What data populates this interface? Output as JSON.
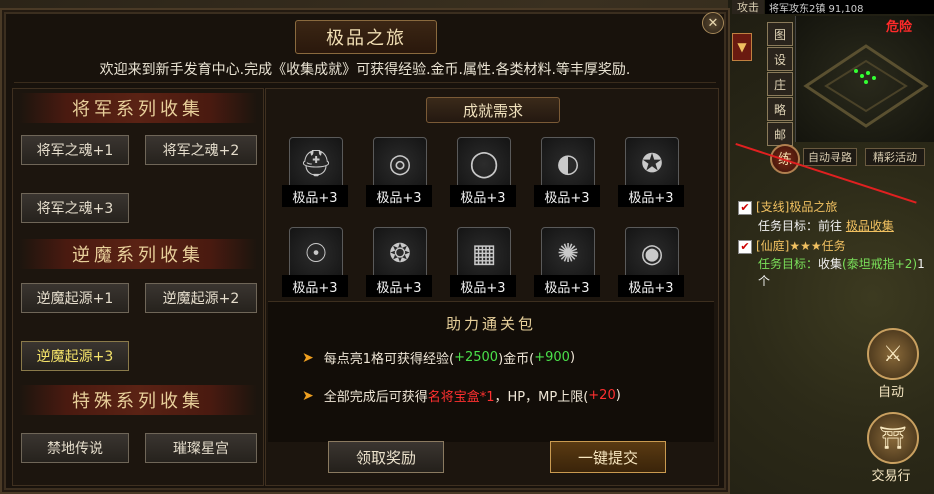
{
  "panel": {
    "title": "极品之旅",
    "close_glyph": "✕",
    "intro": "欢迎来到新手发育中心.完成《收集成就》可获得经验.金币.属性.各类材料.等丰厚奖励."
  },
  "categories": [
    {
      "label": "将军系列收集",
      "items": [
        "将军之魂+1",
        "将军之魂+2",
        "将军之魂+3"
      ]
    },
    {
      "label": "逆魔系列收集",
      "items": [
        "逆魔起源+1",
        "逆魔起源+2",
        "逆魔起源+3"
      ]
    },
    {
      "label": "特殊系列收集",
      "items": [
        "禁地传说",
        "璀璨星宫"
      ]
    }
  ],
  "requirements": {
    "title": "成就需求",
    "slots": [
      {
        "icon": "helmet-icon",
        "glyph": "⛑",
        "label": "极品+3"
      },
      {
        "icon": "necklace-icon",
        "glyph": "◎",
        "label": "极品+3"
      },
      {
        "icon": "ring-icon",
        "glyph": "◯",
        "label": "极品+3"
      },
      {
        "icon": "bracelet-icon",
        "glyph": "◐",
        "label": "极品+3"
      },
      {
        "icon": "ring-icon",
        "glyph": "✪",
        "label": "极品+3"
      },
      {
        "icon": "medal-icon",
        "glyph": "☉",
        "label": "极品+3"
      },
      {
        "icon": "belt-icon",
        "glyph": "❂",
        "label": "极品+3"
      },
      {
        "icon": "bracer-icon",
        "glyph": "▦",
        "label": "极品+3"
      },
      {
        "icon": "amulet-icon",
        "glyph": "✺",
        "label": "极品+3"
      },
      {
        "icon": "ring-icon",
        "glyph": "◉",
        "label": "极品+3"
      }
    ]
  },
  "rewards": {
    "title": "助力通关包",
    "line1": {
      "a": "每点亮1格可获得经验(",
      "b": "+2500",
      "c": ")金币(",
      "d": "+900",
      "e": ")"
    },
    "line2": {
      "a": "全部完成后可获得",
      "b": "名将宝盒*1",
      "c": "，HP，MP上限(",
      "d": "+20",
      "e": ")"
    }
  },
  "buttons": {
    "claim": "领取奖励",
    "submit": "一键提交"
  },
  "hud": {
    "top_text": "将军攻东2镇      91,108",
    "attack_tab": "攻击",
    "danger": "危险",
    "side_tabs": [
      "图",
      "设",
      "庄",
      "略",
      "邮"
    ],
    "lian": "练",
    "auto_path": "自动寻路",
    "events": "精彩活动",
    "quest1": {
      "tag": "[支线]极品之旅",
      "target_label": "任务目标：",
      "target_text": "前往",
      "target_link": "极品收集"
    },
    "quest2": {
      "tag": "[仙庭]★★★任务",
      "target_label": "任务目标：",
      "text1": "收集",
      "item": "(泰坦戒指+2)",
      "text2": "1个"
    },
    "auto_btn": "自动",
    "trade_btn": "交易行"
  },
  "colors": {
    "accent_gold": "#e8cf9a",
    "highlight_green": "#4ae04a",
    "highlight_red": "#ff3030"
  }
}
